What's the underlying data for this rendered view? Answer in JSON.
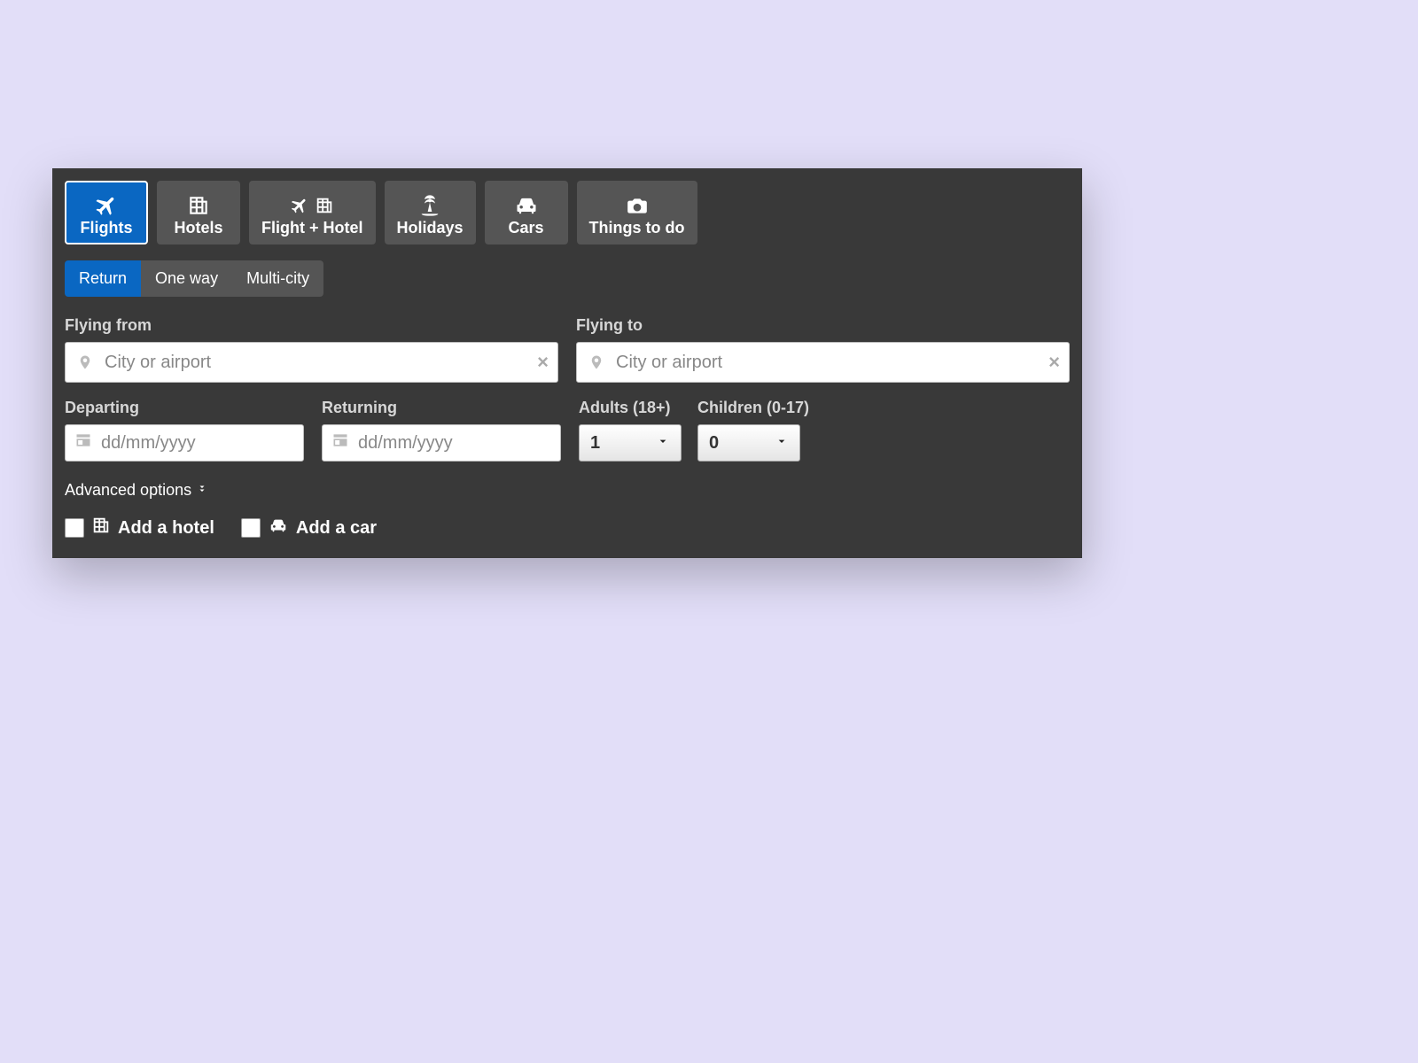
{
  "categories": {
    "flights": "Flights",
    "hotels": "Hotels",
    "flight_hotel": "Flight + Hotel",
    "holidays": "Holidays",
    "cars": "Cars",
    "things": "Things to do"
  },
  "trip": {
    "return": "Return",
    "oneway": "One way",
    "multi": "Multi-city"
  },
  "labels": {
    "from": "Flying from",
    "to": "Flying to",
    "departing": "Departing",
    "returning": "Returning",
    "adults": "Adults (18+)",
    "children": "Children (0-17)"
  },
  "placeholders": {
    "city": "City or airport",
    "date": "dd/mm/yyyy"
  },
  "selects": {
    "adults": "1",
    "children": "0"
  },
  "advanced": "Advanced options",
  "addons": {
    "hotel": "Add a hotel",
    "car": "Add a car"
  }
}
